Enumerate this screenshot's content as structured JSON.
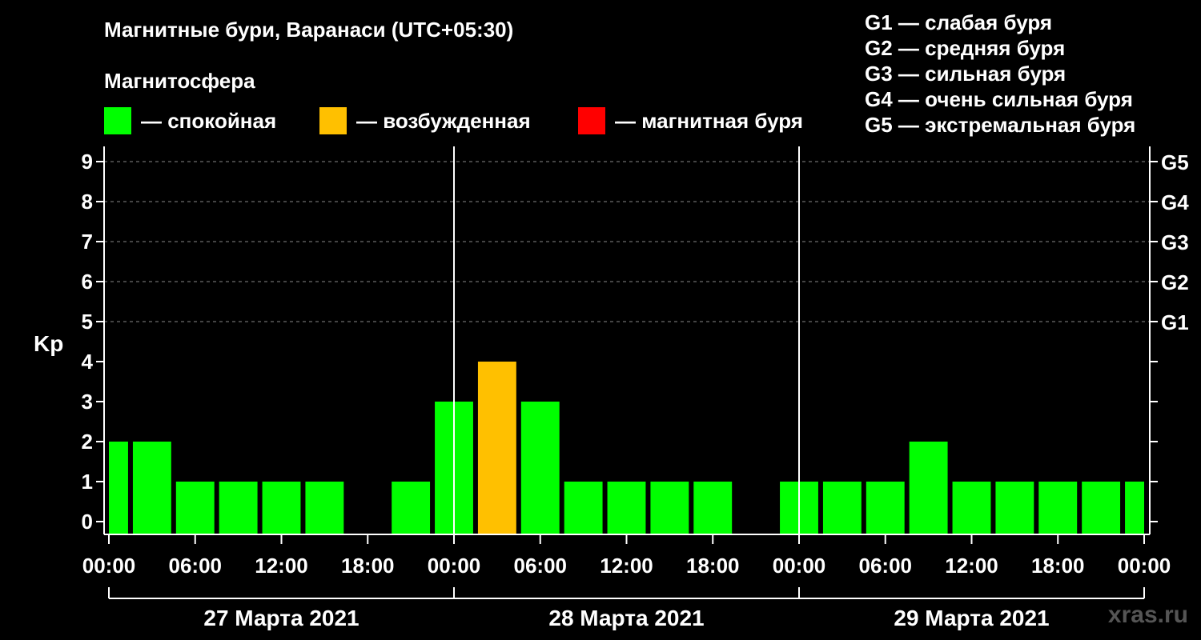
{
  "header": {
    "title": "Магнитные бури, Варанаси (UTC+05:30)",
    "subtitle": "Магнитосфера"
  },
  "legend": [
    {
      "label": "— спокойная",
      "color": "#00ff00"
    },
    {
      "label": "— возбужденная",
      "color": "#ffc000"
    },
    {
      "label": "— магнитная буря",
      "color": "#ff0000"
    }
  ],
  "g_levels": [
    "G1 — слабая буря",
    "G2 — средняя буря",
    "G3 — сильная буря",
    "G4 — очень сильная буря",
    "G5 — экстремальная буря"
  ],
  "watermark": "xras.ru",
  "chart_data": {
    "type": "bar",
    "ylabel": "Kp",
    "ylim": [
      0,
      9
    ],
    "yticks": [
      0,
      1,
      2,
      3,
      4,
      5,
      6,
      7,
      8,
      9
    ],
    "right_axis_labels": [
      {
        "kp": 5,
        "label": "G1"
      },
      {
        "kp": 6,
        "label": "G2"
      },
      {
        "kp": 7,
        "label": "G3"
      },
      {
        "kp": 8,
        "label": "G4"
      },
      {
        "kp": 9,
        "label": "G5"
      }
    ],
    "xtick_labels": [
      "00:00",
      "06:00",
      "12:00",
      "18:00",
      "00:00",
      "06:00",
      "12:00",
      "18:00",
      "00:00",
      "06:00",
      "12:00",
      "18:00",
      "00:00"
    ],
    "days": [
      "27 Марта 2021",
      "28 Марта 2021",
      "29 Марта 2021"
    ],
    "grid": true,
    "legend_position": "top",
    "bars": [
      {
        "start_hour": 0,
        "end_hour": 1.5,
        "kp": 2,
        "level": "quiet"
      },
      {
        "start_hour": 1.5,
        "end_hour": 4.5,
        "kp": 2,
        "level": "quiet"
      },
      {
        "start_hour": 4.5,
        "end_hour": 7.5,
        "kp": 1,
        "level": "quiet"
      },
      {
        "start_hour": 7.5,
        "end_hour": 10.5,
        "kp": 1,
        "level": "quiet"
      },
      {
        "start_hour": 10.5,
        "end_hour": 13.5,
        "kp": 1,
        "level": "quiet"
      },
      {
        "start_hour": 13.5,
        "end_hour": 16.5,
        "kp": 1,
        "level": "quiet"
      },
      {
        "start_hour": 16.5,
        "end_hour": 19.5,
        "kp": 0,
        "level": "quiet"
      },
      {
        "start_hour": 19.5,
        "end_hour": 22.5,
        "kp": 1,
        "level": "quiet"
      },
      {
        "start_hour": 22.5,
        "end_hour": 25.5,
        "kp": 3,
        "level": "quiet"
      },
      {
        "start_hour": 25.5,
        "end_hour": 28.5,
        "kp": 4,
        "level": "active"
      },
      {
        "start_hour": 28.5,
        "end_hour": 31.5,
        "kp": 3,
        "level": "quiet"
      },
      {
        "start_hour": 31.5,
        "end_hour": 34.5,
        "kp": 1,
        "level": "quiet"
      },
      {
        "start_hour": 34.5,
        "end_hour": 37.5,
        "kp": 1,
        "level": "quiet"
      },
      {
        "start_hour": 37.5,
        "end_hour": 40.5,
        "kp": 1,
        "level": "quiet"
      },
      {
        "start_hour": 40.5,
        "end_hour": 43.5,
        "kp": 1,
        "level": "quiet"
      },
      {
        "start_hour": 43.5,
        "end_hour": 46.5,
        "kp": 0,
        "level": "quiet"
      },
      {
        "start_hour": 46.5,
        "end_hour": 49.5,
        "kp": 1,
        "level": "quiet"
      },
      {
        "start_hour": 49.5,
        "end_hour": 52.5,
        "kp": 1,
        "level": "quiet"
      },
      {
        "start_hour": 52.5,
        "end_hour": 55.5,
        "kp": 1,
        "level": "quiet"
      },
      {
        "start_hour": 55.5,
        "end_hour": 58.5,
        "kp": 2,
        "level": "quiet"
      },
      {
        "start_hour": 58.5,
        "end_hour": 61.5,
        "kp": 1,
        "level": "quiet"
      },
      {
        "start_hour": 61.5,
        "end_hour": 64.5,
        "kp": 1,
        "level": "quiet"
      },
      {
        "start_hour": 64.5,
        "end_hour": 67.5,
        "kp": 1,
        "level": "quiet"
      },
      {
        "start_hour": 67.5,
        "end_hour": 70.5,
        "kp": 1,
        "level": "quiet"
      },
      {
        "start_hour": 70.5,
        "end_hour": 72,
        "kp": 1,
        "level": "quiet"
      }
    ],
    "level_colors": {
      "quiet": "#00ff00",
      "active": "#ffc000",
      "storm": "#ff0000"
    }
  }
}
